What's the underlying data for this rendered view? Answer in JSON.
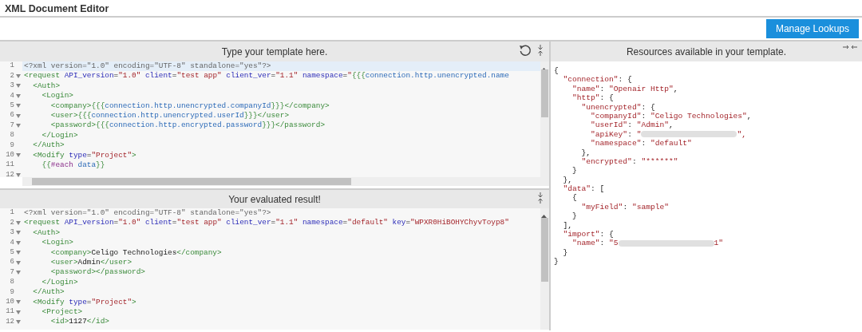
{
  "window": {
    "title": "XML Document Editor"
  },
  "toolbar": {
    "button": "Manage Lookups"
  },
  "template_editor": {
    "title": "Type your template here.",
    "lines": [
      {
        "number": "1",
        "foldable": false,
        "active": true,
        "code": "<?xml version=\"1.0\" encoding=\"UTF-8\" standalone=\"yes\"?>"
      },
      {
        "number": "2",
        "foldable": true,
        "active": false,
        "code": "<request API_version=\"1.0\" client=\"test app\" client_ver=\"1.1\" namespace=\"{{{connection.http.unencrypted.name"
      },
      {
        "number": "3",
        "foldable": true,
        "active": false,
        "code": "  <Auth>"
      },
      {
        "number": "4",
        "foldable": true,
        "active": false,
        "code": "    <Login>"
      },
      {
        "number": "5",
        "foldable": true,
        "active": false,
        "code": "      <company>{{{connection.http.unencrypted.companyId}}}</company>"
      },
      {
        "number": "6",
        "foldable": true,
        "active": false,
        "code": "      <user>{{{connection.http.unencrypted.userId}}}</user>"
      },
      {
        "number": "7",
        "foldable": true,
        "active": false,
        "code": "      <password>{{{connection.http.encrypted.password}}}</password>"
      },
      {
        "number": "8",
        "foldable": false,
        "active": false,
        "code": "    </Login>"
      },
      {
        "number": "9",
        "foldable": false,
        "active": false,
        "code": "  </Auth>"
      },
      {
        "number": "10",
        "foldable": true,
        "active": false,
        "code": "  <Modify type=\"Project\">"
      },
      {
        "number": "11",
        "foldable": false,
        "active": false,
        "code": "    {{#each data}}"
      },
      {
        "number": "12",
        "foldable": true,
        "active": false
      }
    ]
  },
  "result_editor": {
    "title": "Your evaluated result!",
    "lines": [
      {
        "number": "1",
        "foldable": false,
        "code": "<?xml version=\"1.0\" encoding=\"UTF-8\" standalone=\"yes\"?>"
      },
      {
        "number": "2",
        "foldable": true,
        "code": "<request API_version=\"1.0\" client=\"test app\" client_ver=\"1.1\" namespace=\"default\" key=\"WPXR0HiBOHYChyvToyp8\""
      },
      {
        "number": "3",
        "foldable": true,
        "code": "  <Auth>"
      },
      {
        "number": "4",
        "foldable": true,
        "code": "    <Login>"
      },
      {
        "number": "5",
        "foldable": true,
        "code": "      <company>Celigo Technologies</company>"
      },
      {
        "number": "6",
        "foldable": true,
        "code": "      <user>Admin</user>"
      },
      {
        "number": "7",
        "foldable": true,
        "code": "      <password></password>"
      },
      {
        "number": "8",
        "foldable": false,
        "code": "    </Login>"
      },
      {
        "number": "9",
        "foldable": false,
        "code": "  </Auth>"
      },
      {
        "number": "10",
        "foldable": true,
        "code": "  <Modify type=\"Project\">"
      },
      {
        "number": "11",
        "foldable": true,
        "code": "    <Project>"
      },
      {
        "number": "12",
        "foldable": true,
        "code": "      <id>1127</id>"
      }
    ]
  },
  "resources": {
    "title": "Resources available in your template.",
    "lines": [
      {
        "code": "{"
      },
      {
        "code": "  \"connection\": {"
      },
      {
        "code": "    \"name\": \"Openair Http\","
      },
      {
        "code": "    \"http\": {"
      },
      {
        "code": "      \"unencrypted\": {"
      },
      {
        "code": "        \"companyId\": \"Celigo Technologies\","
      },
      {
        "code": "        \"userId\": \"Admin\","
      },
      {
        "code": "        \"apiKey\": \"",
        "redacted": true,
        "after": "\","
      },
      {
        "code": "        \"namespace\": \"default\""
      },
      {
        "code": "      },"
      },
      {
        "code": "      \"encrypted\": \"******\""
      },
      {
        "code": "    }"
      },
      {
        "code": "  },"
      },
      {
        "code": "  \"data\": ["
      },
      {
        "code": "    {"
      },
      {
        "code": "      \"myField\": \"sample\""
      },
      {
        "code": "    }"
      },
      {
        "code": "  ],"
      },
      {
        "code": "  \"import\": {"
      },
      {
        "code": "    \"name\": \"5",
        "redacted": true,
        "after": "1\""
      },
      {
        "code": "  }"
      },
      {
        "code": "}"
      }
    ]
  }
}
